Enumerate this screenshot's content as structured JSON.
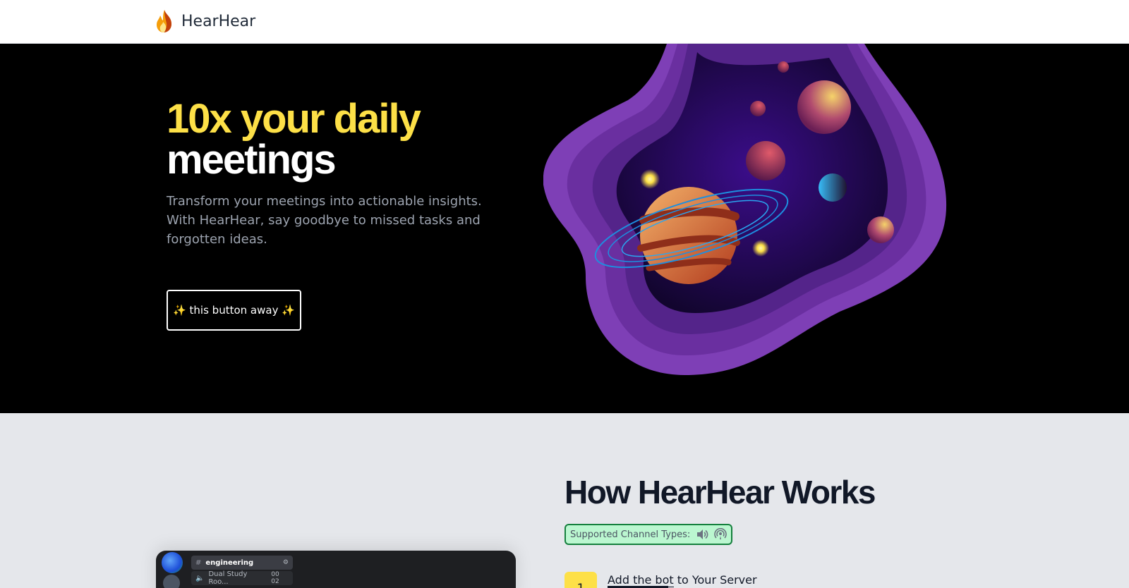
{
  "header": {
    "brand": "HearHear",
    "logo_icon": "flame-icon"
  },
  "hero": {
    "title_highlight": "10x your daily",
    "title_rest": "meetings",
    "subtitle": "Transform your meetings into actionable insights. With HearHear, say goodbye to missed tasks and forgotten ideas.",
    "cta_label": "✨ this button away ✨",
    "illustration": "planet-space-illustration"
  },
  "how": {
    "title": "How HearHear Works",
    "channel_badge": {
      "label": "Supported Channel Types:",
      "icons": [
        "speaker-icon",
        "podcast-icon"
      ]
    },
    "steps": [
      {
        "number": "1",
        "link_text": "Add the bot",
        "rest_text": " to Your Server"
      }
    ],
    "screenshot": {
      "channels": [
        {
          "name": "engineering",
          "icon": "hash-icon"
        },
        {
          "name": "Dual Study Roo...",
          "icon": "speaker-icon",
          "meta": "00  02"
        }
      ]
    }
  },
  "colors": {
    "accent_yellow": "#fde047",
    "hero_bg": "#000000",
    "section_bg": "#e5e7eb",
    "badge_bg": "#bbf7d0",
    "badge_border": "#15803d",
    "planet_purple": "#7e3fb6"
  }
}
